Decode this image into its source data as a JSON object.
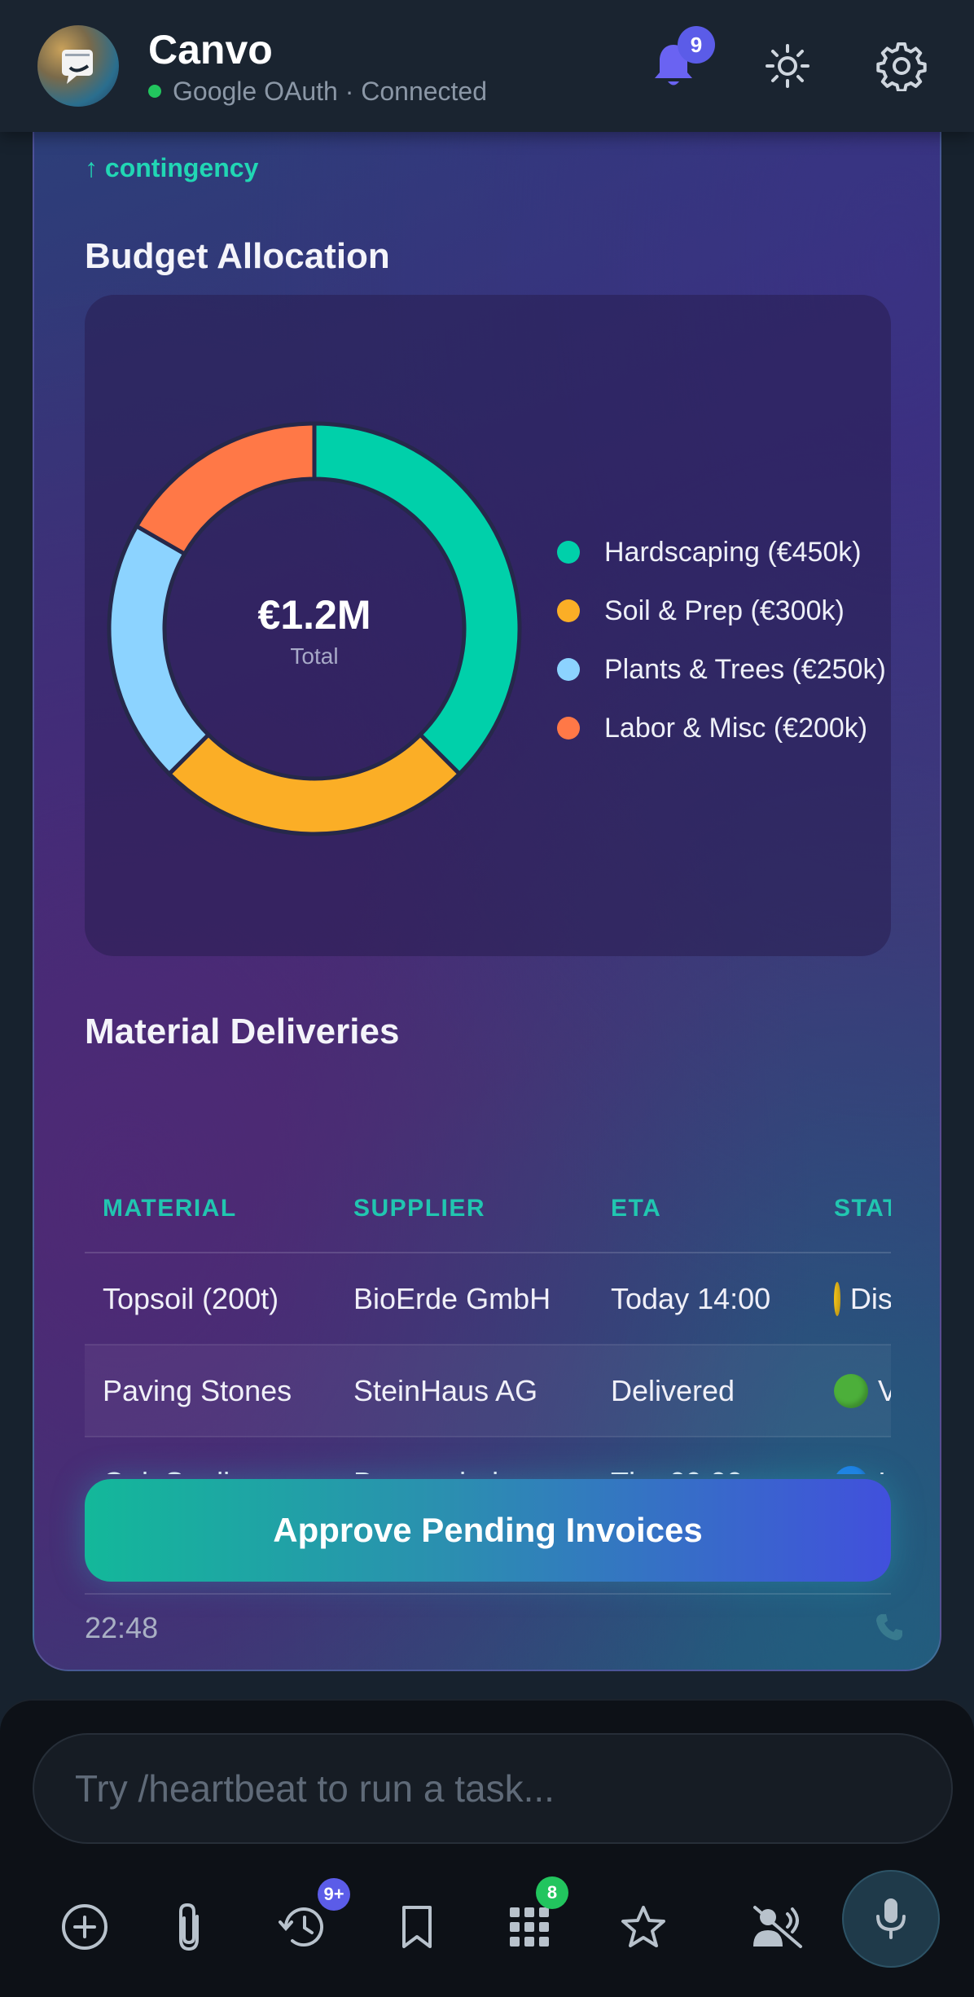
{
  "header": {
    "title": "Canvo",
    "status": "Google OAuth · Connected",
    "notification_count": "9"
  },
  "card": {
    "contingency_label": "↑ contingency",
    "budget": {
      "title": "Budget Allocation",
      "center_value": "€1.2M",
      "center_label": "Total"
    },
    "deliveries": {
      "title": "Material Deliveries",
      "columns": [
        "MATERIAL",
        "SUPPLIER",
        "ETA",
        "STATUS"
      ],
      "rows": [
        {
          "material": "Topsoil (200t)",
          "supplier": "BioErde GmbH",
          "eta": "Today 14:00",
          "status": "Dispatched",
          "status_color": "#f7c51a"
        },
        {
          "material": "Paving Stones",
          "supplier": "SteinHaus AG",
          "eta": "Delivered",
          "status": "Verified",
          "status_color": "#4caf3a"
        },
        {
          "material": "Oak Saplings",
          "supplier": "Baumschule",
          "eta": "Thu 09:00",
          "status": "In transit",
          "status_color": "#1e7ee6"
        }
      ]
    },
    "approve_label": "Approve Pending Invoices",
    "timestamp": "22:48"
  },
  "chart_data": {
    "type": "pie",
    "categories": [
      "Hardscaping (€450k)",
      "Soil & Prep (€300k)",
      "Plants & Trees (€250k)",
      "Labor & Misc (€200k)"
    ],
    "values": [
      450,
      300,
      250,
      200
    ],
    "colors": [
      "#00d0aa",
      "#fbae26",
      "#8cd3ff",
      "#ff7847"
    ],
    "title": "Budget Allocation"
  },
  "composer": {
    "placeholder": "Try /heartbeat to run a task...",
    "history_badge": "9+",
    "apps_badge": "8"
  },
  "colors": {
    "accent_teal": "#21d6b4",
    "badge_purple": "#5b5ce8",
    "badge_green": "#22c55e"
  }
}
